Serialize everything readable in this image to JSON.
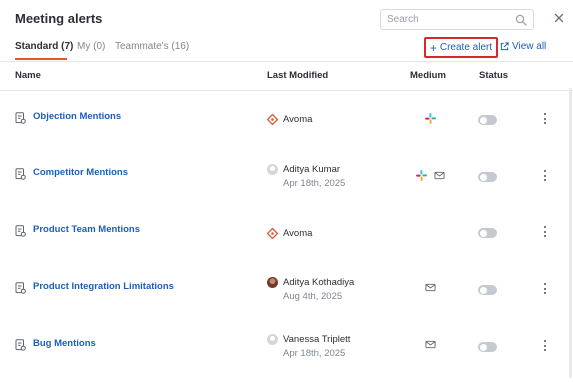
{
  "header": {
    "title": "Meeting alerts",
    "search_placeholder": "Search"
  },
  "tabs": [
    {
      "label": "Standard (7)",
      "active": true
    },
    {
      "label": "My (0)",
      "active": false
    },
    {
      "label": "Teammate's (16)",
      "active": false
    }
  ],
  "actions": {
    "create_label": "Create alert",
    "view_all_label": "View all"
  },
  "table": {
    "columns": [
      "Name",
      "Last Modified",
      "Medium",
      "Status"
    ],
    "rows": [
      {
        "name": "Objection Mentions",
        "modified_by": "Avoma",
        "modified_date": "",
        "modifier_type": "avoma-logo",
        "medium": [
          "slack-icon"
        ],
        "status_on": false
      },
      {
        "name": "Competitor Mentions",
        "modified_by": "Aditya Kumar",
        "modified_date": "Apr 18th, 2025",
        "modifier_type": "avatar-placeholder",
        "medium": [
          "slack-icon",
          "mail-icon"
        ],
        "status_on": false
      },
      {
        "name": "Product Team Mentions",
        "modified_by": "Avoma",
        "modified_date": "",
        "modifier_type": "avoma-logo",
        "medium": [],
        "status_on": false
      },
      {
        "name": "Product Integration Limitations",
        "modified_by": "Aditya Kothadiya",
        "modified_date": "Aug 4th, 2025",
        "modifier_type": "avatar-photo",
        "medium": [
          "mail-icon"
        ],
        "status_on": false
      },
      {
        "name": "Bug Mentions",
        "modified_by": "Vanessa Triplett",
        "modified_date": "Apr 18th, 2025",
        "modifier_type": "avatar-placeholder",
        "medium": [
          "mail-icon"
        ],
        "status_on": false
      }
    ]
  },
  "colors": {
    "link": "#1d5fb8",
    "tab_accent": "#e4572e",
    "highlight_border": "#d22b2b",
    "toggle_off": "#c5cad0",
    "avoma_brand": "#e4572e"
  }
}
